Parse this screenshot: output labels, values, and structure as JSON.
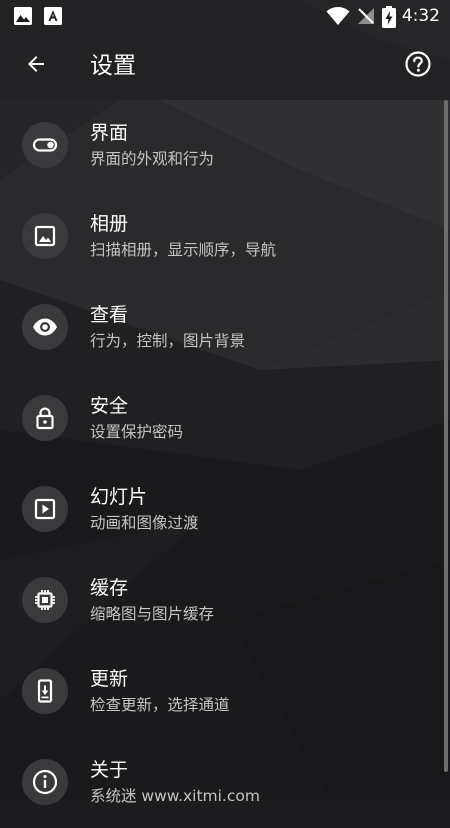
{
  "status_bar": {
    "time": "4:32",
    "left_icons": [
      "image-icon",
      "text-icon"
    ],
    "right_icons": [
      "wifi-icon",
      "cellular-no-signal-icon",
      "battery-charging-icon"
    ]
  },
  "app_bar": {
    "title": "设置",
    "back_icon": "arrow-back-icon",
    "help_icon": "help-icon"
  },
  "settings": [
    {
      "icon": "toggle-icon",
      "title": "界面",
      "subtitle": "界面的外观和行为"
    },
    {
      "icon": "image-icon",
      "title": "相册",
      "subtitle": "扫描相册，显示顺序，导航"
    },
    {
      "icon": "eye-icon",
      "title": "查看",
      "subtitle": "行为，控制，图片背景"
    },
    {
      "icon": "lock-icon",
      "title": "安全",
      "subtitle": "设置保护密码"
    },
    {
      "icon": "slideshow-icon",
      "title": "幻灯片",
      "subtitle": "动画和图像过渡"
    },
    {
      "icon": "chip-icon",
      "title": "缓存",
      "subtitle": "缩略图与图片缓存"
    },
    {
      "icon": "phone-download-icon",
      "title": "更新",
      "subtitle": "检查更新，选择通道"
    },
    {
      "icon": "info-icon",
      "title": "关于",
      "subtitle": "系统迷 www.xitmi.com"
    }
  ],
  "colors": {
    "background": "#1c1c1e",
    "icon_circle": "#3a3a3c",
    "text_primary": "#ffffff",
    "text_secondary": "#c4c4c4"
  }
}
